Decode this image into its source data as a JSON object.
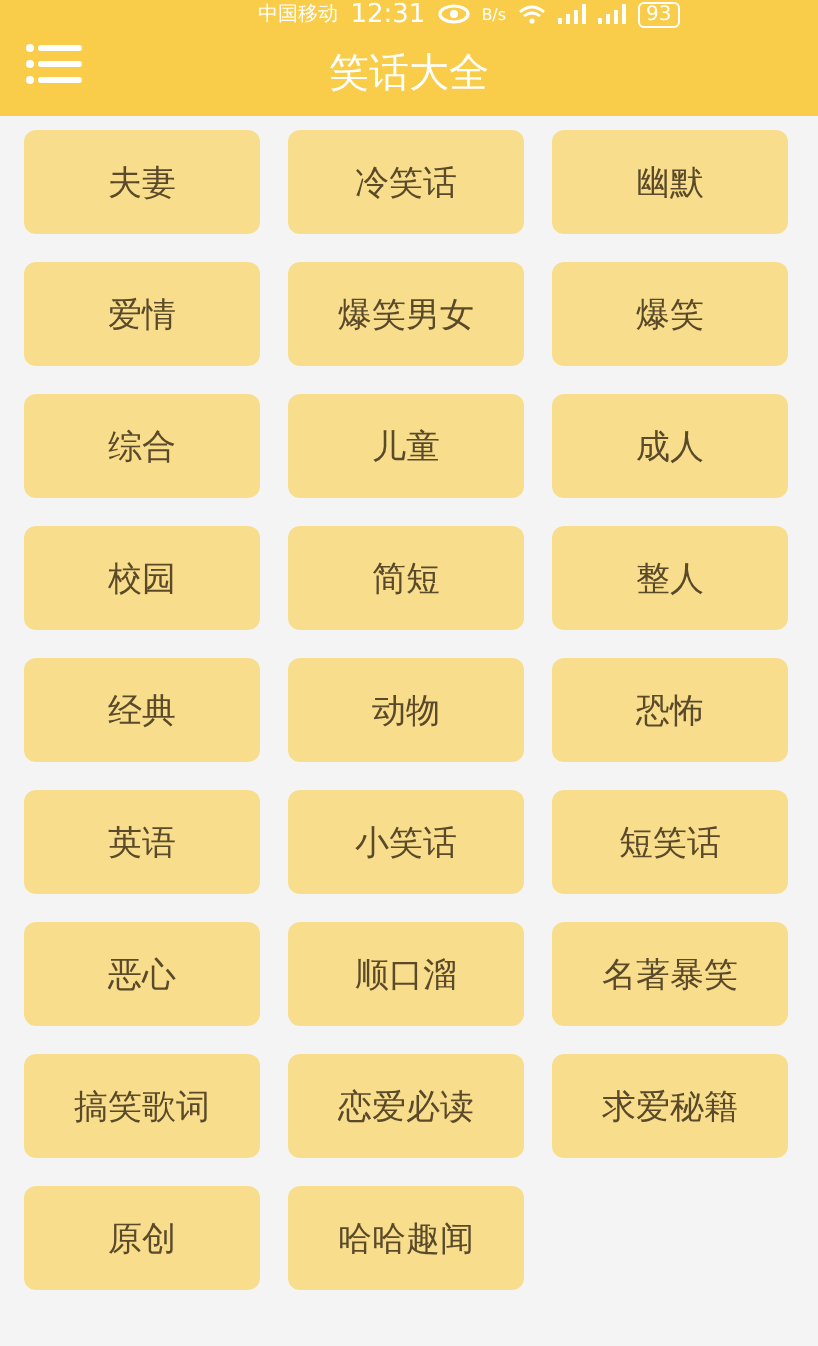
{
  "status_bar": {
    "carrier": "中国移动",
    "time": "12:31",
    "speed_unit": "B/s",
    "battery": "93"
  },
  "header": {
    "title": "笑话大全"
  },
  "categories": [
    "夫妻",
    "冷笑话",
    "幽默",
    "爱情",
    "爆笑男女",
    "爆笑",
    "综合",
    "儿童",
    "成人",
    "校园",
    "简短",
    "整人",
    "经典",
    "动物",
    "恐怖",
    "英语",
    "小笑话",
    "短笑话",
    "恶心",
    "顺口溜",
    "名著暴笑",
    "搞笑歌词",
    "恋爱必读",
    "求爱秘籍",
    "原创",
    "哈哈趣闻"
  ]
}
